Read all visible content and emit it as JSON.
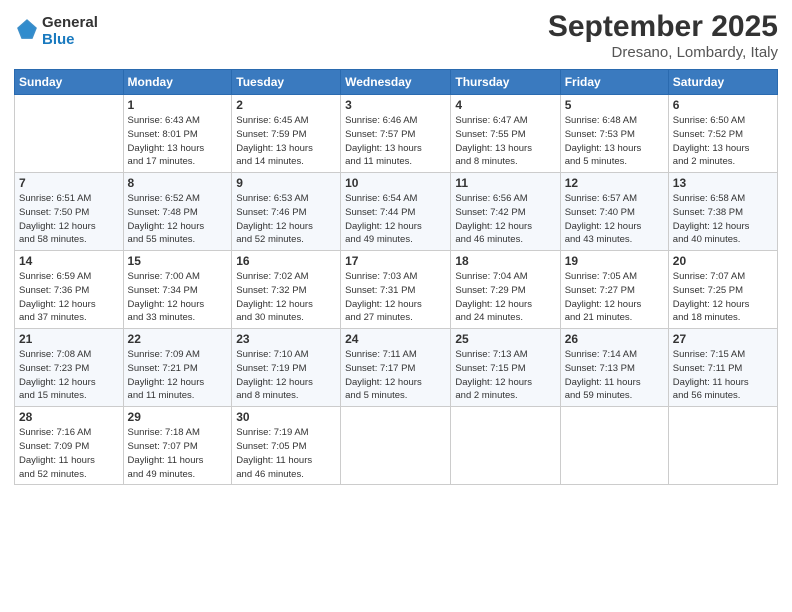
{
  "logo": {
    "general": "General",
    "blue": "Blue"
  },
  "header": {
    "title": "September 2025",
    "location": "Dresano, Lombardy, Italy"
  },
  "columns": [
    "Sunday",
    "Monday",
    "Tuesday",
    "Wednesday",
    "Thursday",
    "Friday",
    "Saturday"
  ],
  "weeks": [
    [
      {
        "day": "",
        "info": ""
      },
      {
        "day": "1",
        "info": "Sunrise: 6:43 AM\nSunset: 8:01 PM\nDaylight: 13 hours\nand 17 minutes."
      },
      {
        "day": "2",
        "info": "Sunrise: 6:45 AM\nSunset: 7:59 PM\nDaylight: 13 hours\nand 14 minutes."
      },
      {
        "day": "3",
        "info": "Sunrise: 6:46 AM\nSunset: 7:57 PM\nDaylight: 13 hours\nand 11 minutes."
      },
      {
        "day": "4",
        "info": "Sunrise: 6:47 AM\nSunset: 7:55 PM\nDaylight: 13 hours\nand 8 minutes."
      },
      {
        "day": "5",
        "info": "Sunrise: 6:48 AM\nSunset: 7:53 PM\nDaylight: 13 hours\nand 5 minutes."
      },
      {
        "day": "6",
        "info": "Sunrise: 6:50 AM\nSunset: 7:52 PM\nDaylight: 13 hours\nand 2 minutes."
      }
    ],
    [
      {
        "day": "7",
        "info": "Sunrise: 6:51 AM\nSunset: 7:50 PM\nDaylight: 12 hours\nand 58 minutes."
      },
      {
        "day": "8",
        "info": "Sunrise: 6:52 AM\nSunset: 7:48 PM\nDaylight: 12 hours\nand 55 minutes."
      },
      {
        "day": "9",
        "info": "Sunrise: 6:53 AM\nSunset: 7:46 PM\nDaylight: 12 hours\nand 52 minutes."
      },
      {
        "day": "10",
        "info": "Sunrise: 6:54 AM\nSunset: 7:44 PM\nDaylight: 12 hours\nand 49 minutes."
      },
      {
        "day": "11",
        "info": "Sunrise: 6:56 AM\nSunset: 7:42 PM\nDaylight: 12 hours\nand 46 minutes."
      },
      {
        "day": "12",
        "info": "Sunrise: 6:57 AM\nSunset: 7:40 PM\nDaylight: 12 hours\nand 43 minutes."
      },
      {
        "day": "13",
        "info": "Sunrise: 6:58 AM\nSunset: 7:38 PM\nDaylight: 12 hours\nand 40 minutes."
      }
    ],
    [
      {
        "day": "14",
        "info": "Sunrise: 6:59 AM\nSunset: 7:36 PM\nDaylight: 12 hours\nand 37 minutes."
      },
      {
        "day": "15",
        "info": "Sunrise: 7:00 AM\nSunset: 7:34 PM\nDaylight: 12 hours\nand 33 minutes."
      },
      {
        "day": "16",
        "info": "Sunrise: 7:02 AM\nSunset: 7:32 PM\nDaylight: 12 hours\nand 30 minutes."
      },
      {
        "day": "17",
        "info": "Sunrise: 7:03 AM\nSunset: 7:31 PM\nDaylight: 12 hours\nand 27 minutes."
      },
      {
        "day": "18",
        "info": "Sunrise: 7:04 AM\nSunset: 7:29 PM\nDaylight: 12 hours\nand 24 minutes."
      },
      {
        "day": "19",
        "info": "Sunrise: 7:05 AM\nSunset: 7:27 PM\nDaylight: 12 hours\nand 21 minutes."
      },
      {
        "day": "20",
        "info": "Sunrise: 7:07 AM\nSunset: 7:25 PM\nDaylight: 12 hours\nand 18 minutes."
      }
    ],
    [
      {
        "day": "21",
        "info": "Sunrise: 7:08 AM\nSunset: 7:23 PM\nDaylight: 12 hours\nand 15 minutes."
      },
      {
        "day": "22",
        "info": "Sunrise: 7:09 AM\nSunset: 7:21 PM\nDaylight: 12 hours\nand 11 minutes."
      },
      {
        "day": "23",
        "info": "Sunrise: 7:10 AM\nSunset: 7:19 PM\nDaylight: 12 hours\nand 8 minutes."
      },
      {
        "day": "24",
        "info": "Sunrise: 7:11 AM\nSunset: 7:17 PM\nDaylight: 12 hours\nand 5 minutes."
      },
      {
        "day": "25",
        "info": "Sunrise: 7:13 AM\nSunset: 7:15 PM\nDaylight: 12 hours\nand 2 minutes."
      },
      {
        "day": "26",
        "info": "Sunrise: 7:14 AM\nSunset: 7:13 PM\nDaylight: 11 hours\nand 59 minutes."
      },
      {
        "day": "27",
        "info": "Sunrise: 7:15 AM\nSunset: 7:11 PM\nDaylight: 11 hours\nand 56 minutes."
      }
    ],
    [
      {
        "day": "28",
        "info": "Sunrise: 7:16 AM\nSunset: 7:09 PM\nDaylight: 11 hours\nand 52 minutes."
      },
      {
        "day": "29",
        "info": "Sunrise: 7:18 AM\nSunset: 7:07 PM\nDaylight: 11 hours\nand 49 minutes."
      },
      {
        "day": "30",
        "info": "Sunrise: 7:19 AM\nSunset: 7:05 PM\nDaylight: 11 hours\nand 46 minutes."
      },
      {
        "day": "",
        "info": ""
      },
      {
        "day": "",
        "info": ""
      },
      {
        "day": "",
        "info": ""
      },
      {
        "day": "",
        "info": ""
      }
    ]
  ]
}
